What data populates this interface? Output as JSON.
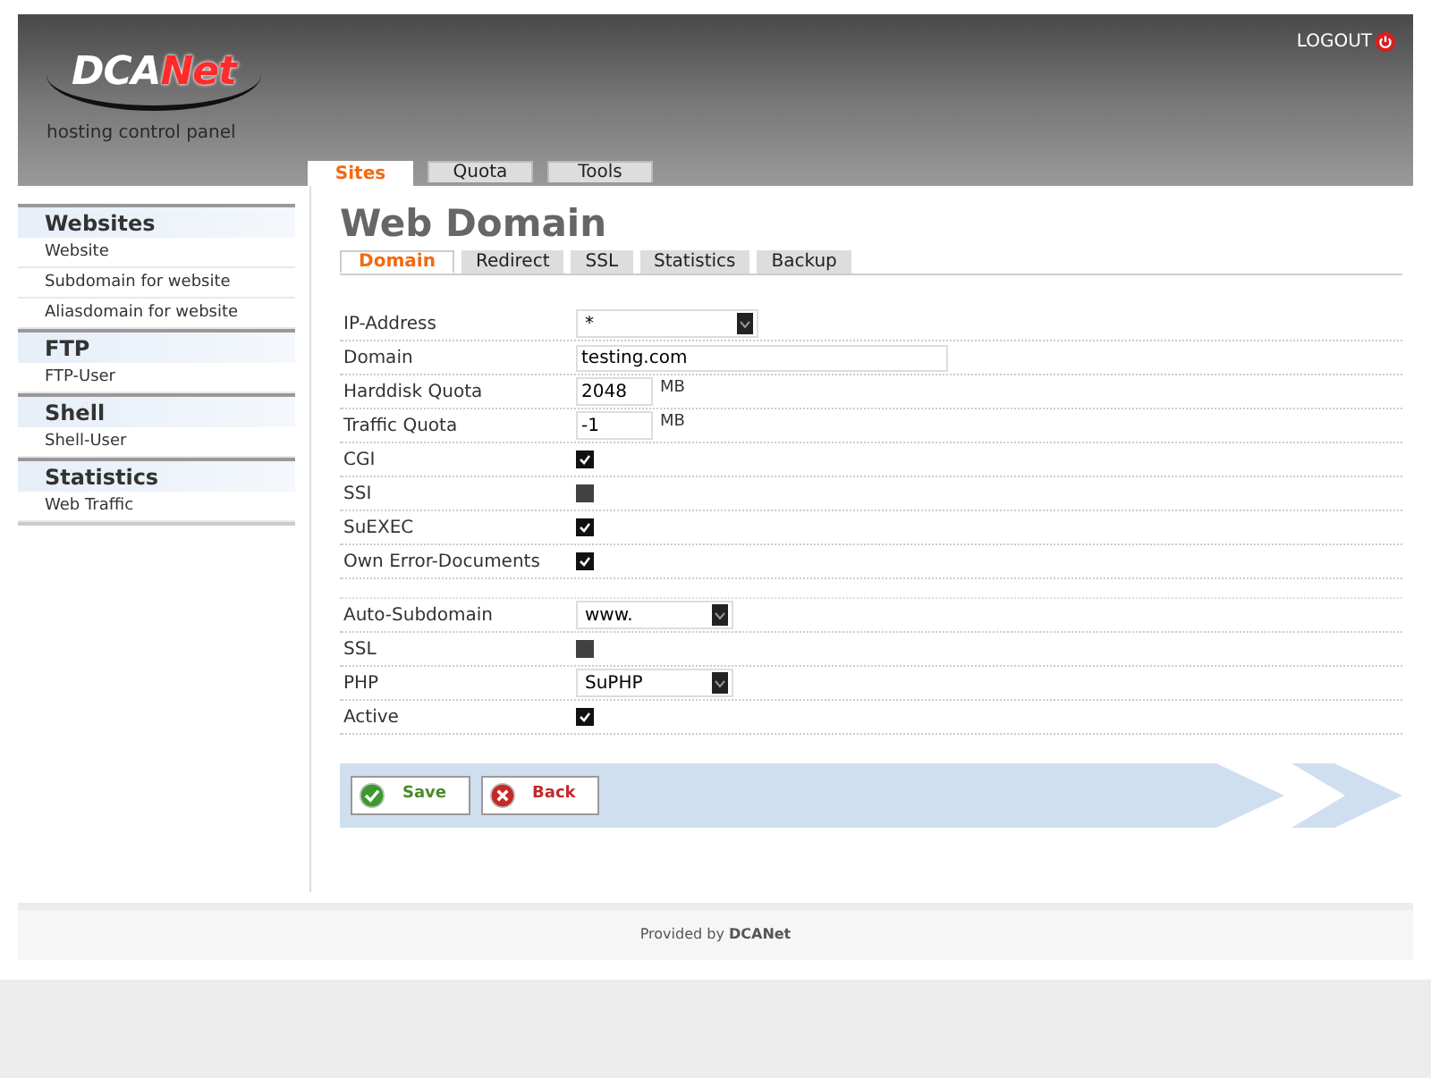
{
  "header": {
    "logo": [
      "DCA",
      "Net"
    ],
    "subtitle": "hosting control panel",
    "logout": "LOGOUT"
  },
  "main_tabs": [
    {
      "label": "Sites",
      "selected": true
    },
    {
      "label": "Quota",
      "selected": false
    },
    {
      "label": "Tools",
      "selected": false
    }
  ],
  "sidebar": [
    {
      "title": "Websites",
      "items": [
        "Website",
        "Subdomain for website",
        "Aliasdomain for website"
      ]
    },
    {
      "title": "FTP",
      "items": [
        "FTP-User"
      ]
    },
    {
      "title": "Shell",
      "items": [
        "Shell-User"
      ]
    },
    {
      "title": "Statistics",
      "items": [
        "Web Traffic"
      ]
    }
  ],
  "page_title": "Web Domain",
  "tabs": [
    {
      "label": "Domain",
      "selected": true
    },
    {
      "label": "Redirect",
      "selected": false
    },
    {
      "label": "SSL",
      "selected": false
    },
    {
      "label": "Statistics",
      "selected": false
    },
    {
      "label": "Backup",
      "selected": false
    }
  ],
  "form_groups": [
    [
      {
        "kind": "select",
        "label": "IP-Address",
        "value": "*"
      },
      {
        "kind": "text",
        "label": "Domain",
        "value": "testing.com"
      },
      {
        "kind": "number",
        "label": "Harddisk Quota",
        "value": "2048",
        "unit": "MB"
      },
      {
        "kind": "number",
        "label": "Traffic Quota",
        "value": "-1",
        "unit": "MB"
      },
      {
        "kind": "checkbox",
        "label": "CGI",
        "checked": true
      },
      {
        "kind": "checkbox",
        "label": "SSI",
        "checked": false
      },
      {
        "kind": "checkbox",
        "label": "SuEXEC",
        "checked": true
      },
      {
        "kind": "checkbox",
        "label": "Own Error-Documents",
        "checked": true
      }
    ],
    [
      {
        "kind": "select",
        "label": "Auto-Subdomain",
        "value": "www."
      },
      {
        "kind": "checkbox",
        "label": "SSL",
        "checked": false
      },
      {
        "kind": "select",
        "label": "PHP",
        "value": "SuPHP"
      },
      {
        "kind": "checkbox",
        "label": "Active",
        "checked": true
      }
    ]
  ],
  "buttons": [
    {
      "kind": "save",
      "label": "Save"
    },
    {
      "kind": "back",
      "label": "Back"
    }
  ],
  "footer": "Provided by **DCANet**"
}
